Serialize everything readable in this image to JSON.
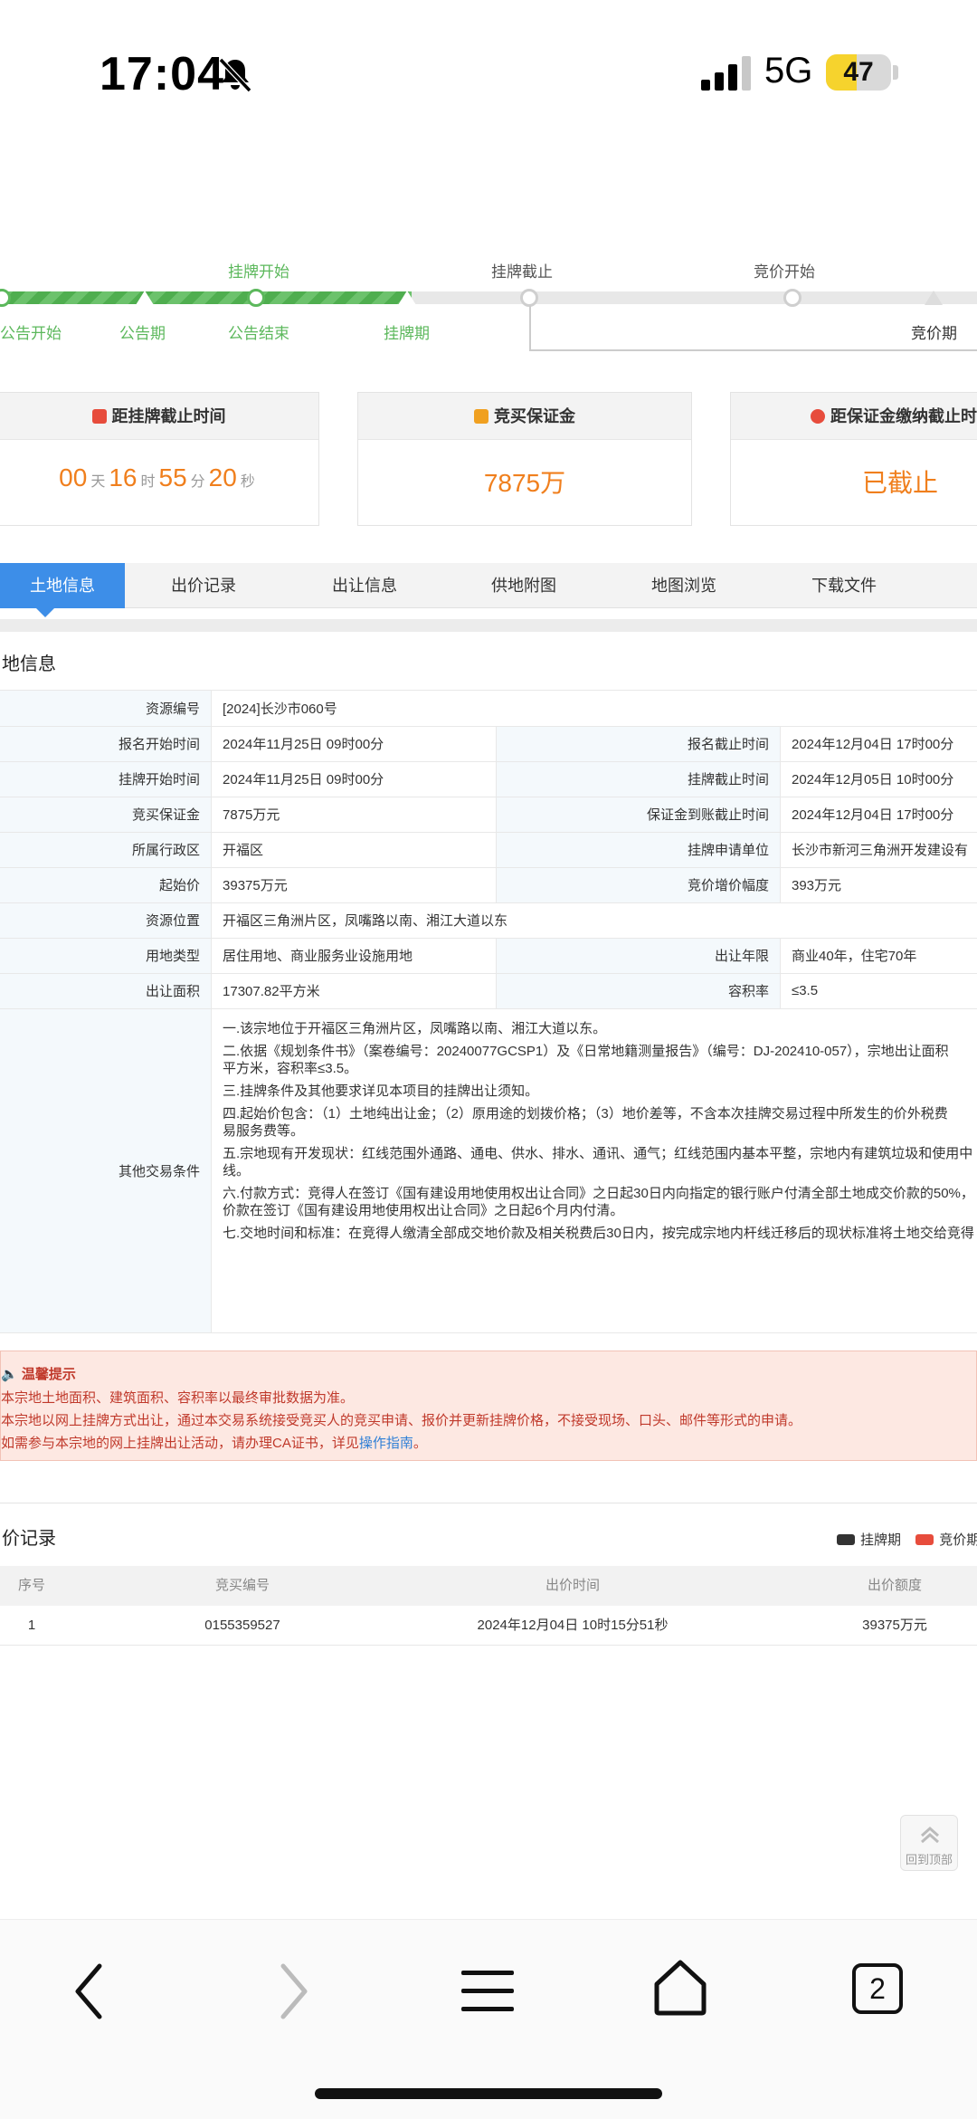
{
  "status_bar": {
    "time": "17:04",
    "network": "5G",
    "battery": "47",
    "battery_level": 0.47
  },
  "timeline": {
    "top_labels": [
      "挂牌开始",
      "挂牌截止",
      "竞价开始"
    ],
    "bottom_labels": [
      "公告开始",
      "公告期",
      "公告结束",
      "挂牌期",
      "竞价期"
    ]
  },
  "cards": [
    {
      "title": "距挂牌截止时间",
      "countdown": {
        "d": "00",
        "d_unit": "天",
        "h": "16",
        "h_unit": "时",
        "m": "55",
        "m_unit": "分",
        "s": "20",
        "s_unit": "秒"
      },
      "icon_color": "#e74c3c"
    },
    {
      "title": "竞买保证金",
      "value": "7875万",
      "icon_color": "#f0a020"
    },
    {
      "title": "距保证金缴纳截止时间",
      "value": "已截止",
      "icon_color": "#e74c3c"
    }
  ],
  "tabs": [
    "土地信息",
    "出价记录",
    "出让信息",
    "供地附图",
    "地图浏览",
    "下载文件"
  ],
  "land_info": {
    "section_title": "地信息",
    "resource_no": {
      "label": "资源编号",
      "value": "[2024]长沙市060号"
    },
    "rows": [
      {
        "l1": "报名开始时间",
        "v1": "2024年11月25日 09时00分",
        "l2": "报名截止时间",
        "v2": "2024年12月04日 17时00分"
      },
      {
        "l1": "挂牌开始时间",
        "v1": "2024年11月25日 09时00分",
        "l2": "挂牌截止时间",
        "v2": "2024年12月05日 10时00分"
      },
      {
        "l1": "竞买保证金",
        "v1": "7875万元",
        "l2": "保证金到账截止时间",
        "v2": "2024年12月04日 17时00分"
      },
      {
        "l1": "所属行政区",
        "v1": "开福区",
        "l2": "挂牌申请单位",
        "v2": "长沙市新河三角洲开发建设有"
      },
      {
        "l1": "起始价",
        "v1": "39375万元",
        "l2": "竞价增价幅度",
        "v2": "393万元"
      }
    ],
    "location": {
      "label": "资源位置",
      "value": "开福区三角洲片区，凤嘴路以南、湘江大道以东"
    },
    "rows2": [
      {
        "l1": "用地类型",
        "v1": "居住用地、商业服务业设施用地",
        "l2": "出让年限",
        "v2": "商业40年，住宅70年"
      },
      {
        "l1": "出让面积",
        "v1": "17307.82平方米",
        "l2": "容积率",
        "v2": "≤3.5"
      }
    ],
    "other_conditions": {
      "label": "其他交易条件",
      "paragraphs": [
        "一.该宗地位于开福区三角洲片区，凤嘴路以南、湘江大道以东。",
        "二.依据《规划条件书》（案卷编号：20240077GCSP1）及《日常地籍测量报告》（编号：DJ-202410-057），宗地出让面积",
        "平方米，容积率≤3.5。",
        "三.挂牌条件及其他要求详见本项目的挂牌出让须知。",
        "四.起始价包含：（1）土地纯出让金；（2）原用途的划拨价格；（3）地价差等，不含本次挂牌交易过程中所发生的价外税费",
        "易服务费等。",
        "五.宗地现有开发现状：红线范围外通路、通电、供水、排水、通讯、通气；红线范围内基本平整，宗地内有建筑垃圾和使用中",
        "线。",
        "六.付款方式：竞得人在签订《国有建设用地使用权出让合同》之日起30日内向指定的银行账户付清全部土地成交价款的50%，",
        "价款在签订《国有建设用地使用权出让合同》之日起6个月内付清。",
        "七.交地时间和标准：在竞得人缴清全部成交地价款及相关税费后30日内，按完成宗地内杆线迁移后的现状标准将土地交给竞得"
      ]
    }
  },
  "tip": {
    "title": "温馨提示",
    "lines": [
      "本宗地土地面积、建筑面积、容积率以最终审批数据为准。",
      "本宗地以网上挂牌方式出让，通过本交易系统接受竞买人的竞买申请、报价并更新挂牌价格，不接受现场、口头、邮件等形式的申请。",
      "如需参与本宗地的网上挂牌出让活动，请办理CA证书，详见"
    ],
    "link": "操作指南",
    "link_suffix": "。"
  },
  "bids": {
    "section_title": "价记录",
    "legend": [
      {
        "label": "挂牌期",
        "color": "#333333"
      },
      {
        "label": "竞价期",
        "color": "#e74c3c"
      }
    ],
    "headers": [
      "序号",
      "竞买编号",
      "出价时间",
      "出价额度"
    ],
    "rows": [
      {
        "no": "1",
        "code": "0155359527",
        "time": "2024年12月04日 10时15分51秒",
        "amount": "39375万元"
      }
    ]
  },
  "back_to_top": "回到顶部",
  "bottom_bar": {
    "tab_count": "2"
  }
}
